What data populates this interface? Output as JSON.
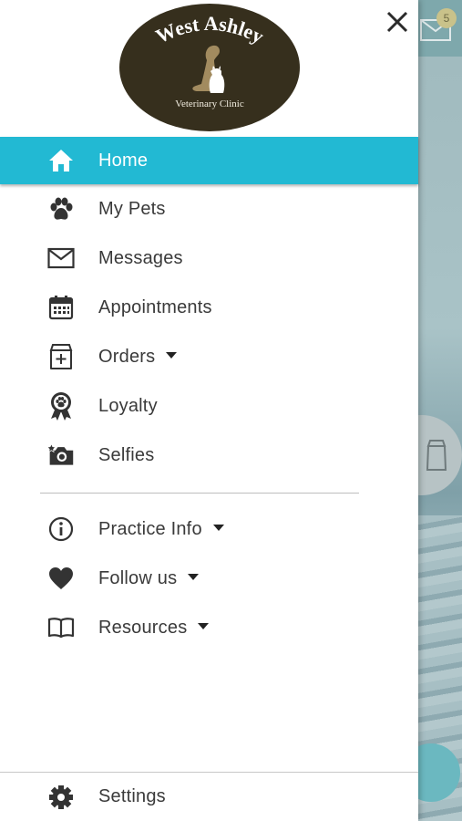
{
  "background": {
    "mail_badge_count": "5"
  },
  "logo": {
    "title": "West Ashley",
    "subtitle": "Veterinary Clinic"
  },
  "colors": {
    "accent": "#22b9d3",
    "logo_bg": "#362f1d"
  },
  "menu": {
    "primary": [
      {
        "label": "Home",
        "icon": "home-icon",
        "active": true
      },
      {
        "label": "My Pets",
        "icon": "paw-icon"
      },
      {
        "label": "Messages",
        "icon": "envelope-icon"
      },
      {
        "label": "Appointments",
        "icon": "calendar-icon"
      },
      {
        "label": "Orders",
        "icon": "medicine-bag-icon",
        "dropdown": true
      },
      {
        "label": "Loyalty",
        "icon": "award-ribbon-icon"
      },
      {
        "label": "Selfies",
        "icon": "camera-icon"
      }
    ],
    "secondary": [
      {
        "label": "Practice Info",
        "icon": "info-icon",
        "dropdown": true
      },
      {
        "label": "Follow us",
        "icon": "heart-icon",
        "dropdown": true
      },
      {
        "label": "Resources",
        "icon": "book-icon",
        "dropdown": true
      }
    ],
    "footer": {
      "label": "Settings",
      "icon": "gear-icon"
    }
  }
}
